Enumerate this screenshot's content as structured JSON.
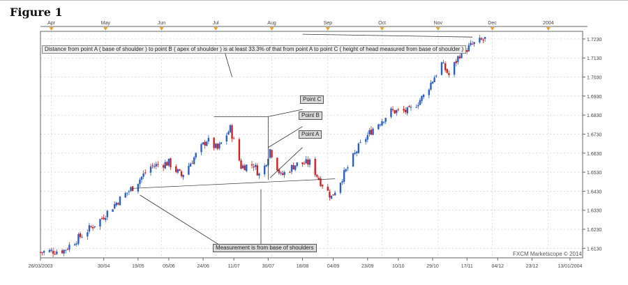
{
  "figure_title": "Figure 1",
  "chart_data": {
    "type": "candlestick",
    "watermark": "FXCM Marketscope © 2014",
    "top_axis_labels": [
      "Apr",
      "May",
      "Jun",
      "Jul",
      "Aug",
      "Sep",
      "Oct",
      "Nov",
      "Dec",
      "2004"
    ],
    "bottom_axis_labels": [
      "26/03/2003",
      "30/04",
      "19/05",
      "05/06",
      "24/06",
      "11/07",
      "30/07",
      "18/08",
      "04/09",
      "23/09",
      "10/10",
      "29/10",
      "17/11",
      "04/12",
      "23/12",
      "13/01/2004"
    ],
    "y_tick_labels": [
      "1.7230",
      "1.7130",
      "1.7030",
      "1.6930",
      "1.6830",
      "1.6730",
      "1.6630",
      "1.6530",
      "1.6430",
      "1.6330",
      "1.6230",
      "1.6130"
    ],
    "ylim": [
      1.608,
      1.727
    ],
    "colors": {
      "up": "#2a5fc9",
      "down": "#d42020",
      "grid": "#c8c8c8",
      "axis": "#666666",
      "marker": "#f0a020"
    },
    "close_path": [
      {
        "date": "2003-03-26",
        "close": 1.611
      },
      {
        "date": "2003-04-08",
        "close": 1.612
      },
      {
        "date": "2003-04-18",
        "close": 1.62
      },
      {
        "date": "2003-04-28",
        "close": 1.628
      },
      {
        "date": "2003-05-08",
        "close": 1.638
      },
      {
        "date": "2003-05-16",
        "close": 1.645
      },
      {
        "date": "2003-05-26",
        "close": 1.656
      },
      {
        "date": "2003-06-05",
        "close": 1.658
      },
      {
        "date": "2003-06-12",
        "close": 1.651
      },
      {
        "date": "2003-06-20",
        "close": 1.662
      },
      {
        "date": "2003-06-26",
        "close": 1.67
      },
      {
        "date": "2003-07-02",
        "close": 1.665
      },
      {
        "date": "2003-07-09",
        "close": 1.676
      },
      {
        "date": "2003-07-15",
        "close": 1.656
      },
      {
        "date": "2003-07-22",
        "close": 1.657
      },
      {
        "date": "2003-07-26",
        "close": 1.65
      },
      {
        "date": "2003-07-31",
        "close": 1.665
      },
      {
        "date": "2003-08-06",
        "close": 1.651
      },
      {
        "date": "2003-08-14",
        "close": 1.657
      },
      {
        "date": "2003-08-22",
        "close": 1.658
      },
      {
        "date": "2003-08-28",
        "close": 1.648
      },
      {
        "date": "2003-09-03",
        "close": 1.64
      },
      {
        "date": "2003-09-10",
        "close": 1.652
      },
      {
        "date": "2003-09-18",
        "close": 1.666
      },
      {
        "date": "2003-09-26",
        "close": 1.676
      },
      {
        "date": "2003-10-06",
        "close": 1.685
      },
      {
        "date": "2003-10-16",
        "close": 1.685
      },
      {
        "date": "2003-10-24",
        "close": 1.693
      },
      {
        "date": "2003-11-03",
        "close": 1.71
      },
      {
        "date": "2003-11-07",
        "close": 1.704
      },
      {
        "date": "2003-11-13",
        "close": 1.715
      },
      {
        "date": "2003-11-20",
        "close": 1.72
      },
      {
        "date": "2003-11-27",
        "close": 1.723
      }
    ],
    "annotations": {
      "distance_note": "Distance from point A ( base of shoulder ) to point B ( apex of shoulder ) is at least 33.3% of that from point A  to point C ( height of head measured from base of shoulder )",
      "point_c": "Point C",
      "point_b": "Point B",
      "point_a": "Point A",
      "measurement_note": "Measurement is from base of shoulders"
    }
  }
}
